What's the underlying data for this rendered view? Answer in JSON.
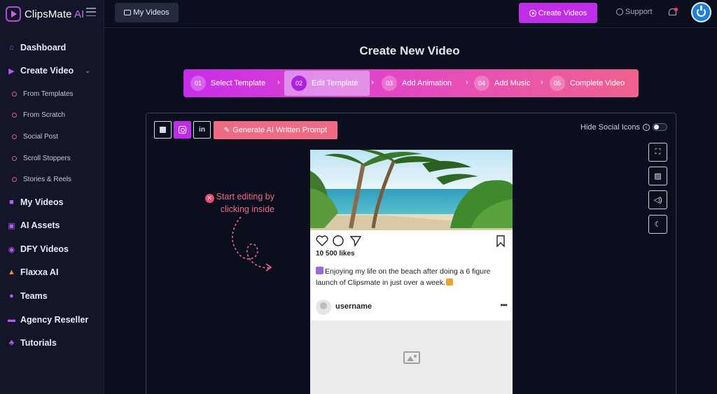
{
  "brand": {
    "name": "ClipsMate",
    "suffix": " AI"
  },
  "sidebar": {
    "items": [
      {
        "label": "Dashboard",
        "icon": "home-icon"
      },
      {
        "label": "Create Video",
        "icon": "play-circle-icon"
      },
      {
        "label": "My Videos",
        "icon": "video-camera-icon"
      },
      {
        "label": "AI Assets",
        "icon": "image-stack-icon"
      },
      {
        "label": "DFY Videos",
        "icon": "play-circle-icon"
      },
      {
        "label": "Flaxxa AI",
        "icon": "flaxxa-icon"
      },
      {
        "label": "Teams",
        "icon": "users-icon"
      },
      {
        "label": "Agency Reseller",
        "icon": "briefcase-icon"
      },
      {
        "label": "Tutorials",
        "icon": "tutorials-icon"
      }
    ],
    "subitems": [
      "From Templates",
      "From Scratch",
      "Social Post",
      "Scroll Stoppers",
      "Stories & Reels"
    ]
  },
  "topbar": {
    "my_videos": "My Videos",
    "create_videos": "Create Videos",
    "support": "Support"
  },
  "page": {
    "title": "Create New Video"
  },
  "steps": [
    {
      "num": "01",
      "label": "Select Template"
    },
    {
      "num": "02",
      "label": "Edit Template"
    },
    {
      "num": "03",
      "label": "Add Animation"
    },
    {
      "num": "04",
      "label": "Add Music"
    },
    {
      "num": "05",
      "label": "Complete Video"
    }
  ],
  "active_step": "02",
  "editor": {
    "generate_button": "Generate AI Written Prompt",
    "hide_social_icons": "Hide Social Icons",
    "hint_line1": "Start editing by",
    "hint_line2": "clicking inside",
    "toggle_on": false
  },
  "post": {
    "likes": "10 500 likes",
    "caption": "Enjoying my life on the beach after doing a 6 figure launch of Clipsmate in just over a week.",
    "username": "username",
    "more": "•••"
  },
  "colors": {
    "accent": "#c02de8",
    "pink": "#ef6a85",
    "background": "#0b0e1c",
    "sidebar": "#131628"
  }
}
